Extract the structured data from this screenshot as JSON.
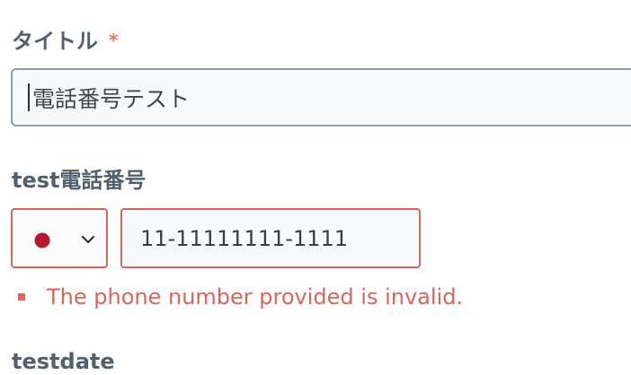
{
  "form": {
    "title_field": {
      "label": "タイトル",
      "required_mark": "*",
      "value": "電話番号テスト"
    },
    "phone_field": {
      "label": "test電話番号",
      "country": {
        "flag_icon": "japan-flag-icon",
        "dropdown_icon": "chevron-down-icon"
      },
      "value": "11-11111111-1111",
      "error": "The phone number provided is invalid."
    },
    "date_field": {
      "label": "testdate"
    }
  },
  "colors": {
    "label": "#525f6f",
    "required": "#e0786a",
    "error": "#d9655b",
    "input_border": "#8e9cb1",
    "flag_red": "#b5172e"
  }
}
